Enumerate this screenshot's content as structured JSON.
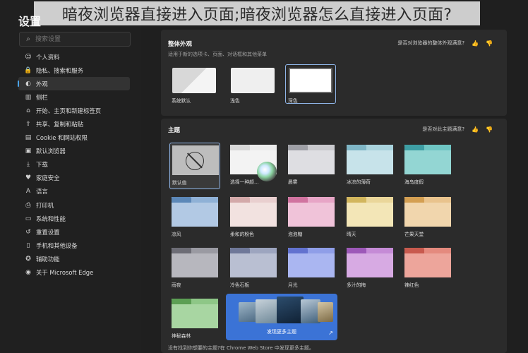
{
  "overlay": {
    "text": "暗夜浏览器直接进入页面;暗夜浏览器怎么直接进入页面?"
  },
  "sidebar": {
    "title": "设置",
    "search_placeholder": "搜索设置",
    "items": [
      {
        "label": "个人资料",
        "icon": "profile-icon",
        "glyph": "☺"
      },
      {
        "label": "隐私、搜索和服务",
        "icon": "lock-icon",
        "glyph": "🔒"
      },
      {
        "label": "外观",
        "icon": "appearance-icon",
        "glyph": "◐"
      },
      {
        "label": "侧栏",
        "icon": "sidebar-icon",
        "glyph": "▥"
      },
      {
        "label": "开始、主页和新建标签页",
        "icon": "home-icon",
        "glyph": "⌂"
      },
      {
        "label": "共享、复制和粘贴",
        "icon": "share-icon",
        "glyph": "⇪"
      },
      {
        "label": "Cookie 和网站权限",
        "icon": "permissions-icon",
        "glyph": "▤"
      },
      {
        "label": "默认浏览器",
        "icon": "browser-icon",
        "glyph": "▣"
      },
      {
        "label": "下载",
        "icon": "download-icon",
        "glyph": "⤓"
      },
      {
        "label": "家庭安全",
        "icon": "family-icon",
        "glyph": "♥"
      },
      {
        "label": "语言",
        "icon": "language-icon",
        "glyph": "A"
      },
      {
        "label": "打印机",
        "icon": "printer-icon",
        "glyph": "⎙"
      },
      {
        "label": "系统和性能",
        "icon": "system-icon",
        "glyph": "▭"
      },
      {
        "label": "重置设置",
        "icon": "reset-icon",
        "glyph": "↺"
      },
      {
        "label": "手机和其他设备",
        "icon": "phone-icon",
        "glyph": "▯"
      },
      {
        "label": "辅助功能",
        "icon": "accessibility-icon",
        "glyph": "✪"
      },
      {
        "label": "关于 Microsoft Edge",
        "icon": "edge-icon",
        "glyph": "◉"
      }
    ],
    "active_index": 2
  },
  "appearance": {
    "title": "整体外观",
    "subtitle": "适用于新的选项卡、页面、对话框和其他菜单",
    "feedback": "是否对浏览器的整体外观满意?",
    "options": [
      {
        "label": "系统默认",
        "selected": false
      },
      {
        "label": "浅色",
        "selected": false
      },
      {
        "label": "深色",
        "selected": true
      }
    ]
  },
  "themes": {
    "title": "主题",
    "feedback": "是否对此主题满意?",
    "items": [
      {
        "label": "默认值",
        "strip": "#bdbdbd",
        "tab": "#bdbdbd",
        "body": "#bdbdbd",
        "selected": true
      },
      {
        "label": "选择一种颜...",
        "strip": "#ececec",
        "tab": "#d8d8d8",
        "body": "#f3f3f3"
      },
      {
        "label": "晨雾",
        "strip": "#c9c9cd",
        "tab": "#9fa0a6",
        "body": "#dedee2"
      },
      {
        "label": "冰凉的薄荷",
        "strip": "#a9d3dd",
        "tab": "#7fb6c6",
        "body": "#c7e3ea"
      },
      {
        "label": "海岛度假",
        "strip": "#6fc6c4",
        "tab": "#3e9ea4",
        "body": "#93d6d3"
      },
      {
        "label": "凉风",
        "strip": "#8fb1d6",
        "tab": "#5c88b8",
        "body": "#b2c9e4"
      },
      {
        "label": "柔和的粉色",
        "strip": "#e9cfcf",
        "tab": "#d3a9a9",
        "body": "#f2e2e0"
      },
      {
        "label": "泡泡糖",
        "strip": "#e7a5c6",
        "tab": "#d0739f",
        "body": "#f0c3d9"
      },
      {
        "label": "晴天",
        "strip": "#ead69a",
        "tab": "#d2b65d",
        "body": "#f3e6b7"
      },
      {
        "label": "芒果天堂",
        "strip": "#e9c38d",
        "tab": "#d49f52",
        "body": "#f1d6ad"
      },
      {
        "label": "雨夜",
        "strip": "#9a9aa2",
        "tab": "#6d6d76",
        "body": "#b7b7be"
      },
      {
        "label": "冷色石板",
        "strip": "#9da5bf",
        "tab": "#6f7899",
        "body": "#b9bfd2"
      },
      {
        "label": "月光",
        "strip": "#8f9ee8",
        "tab": "#6272cf",
        "body": "#aab6f1"
      },
      {
        "label": "多汁的梅",
        "strip": "#c58bd6",
        "tab": "#9d58b8",
        "body": "#d7aae3"
      },
      {
        "label": "辣红色",
        "strip": "#e48a7e",
        "tab": "#c85a4e",
        "body": "#eda59b"
      },
      {
        "label": "神秘森林",
        "strip": "#8ec787",
        "tab": "#5c9f54",
        "body": "#a8d6a2"
      }
    ],
    "discover_label": "发现更多主题",
    "footer": "没有找到你想要的主题?在 Chrome Web Store 中发现更多主题。"
  }
}
